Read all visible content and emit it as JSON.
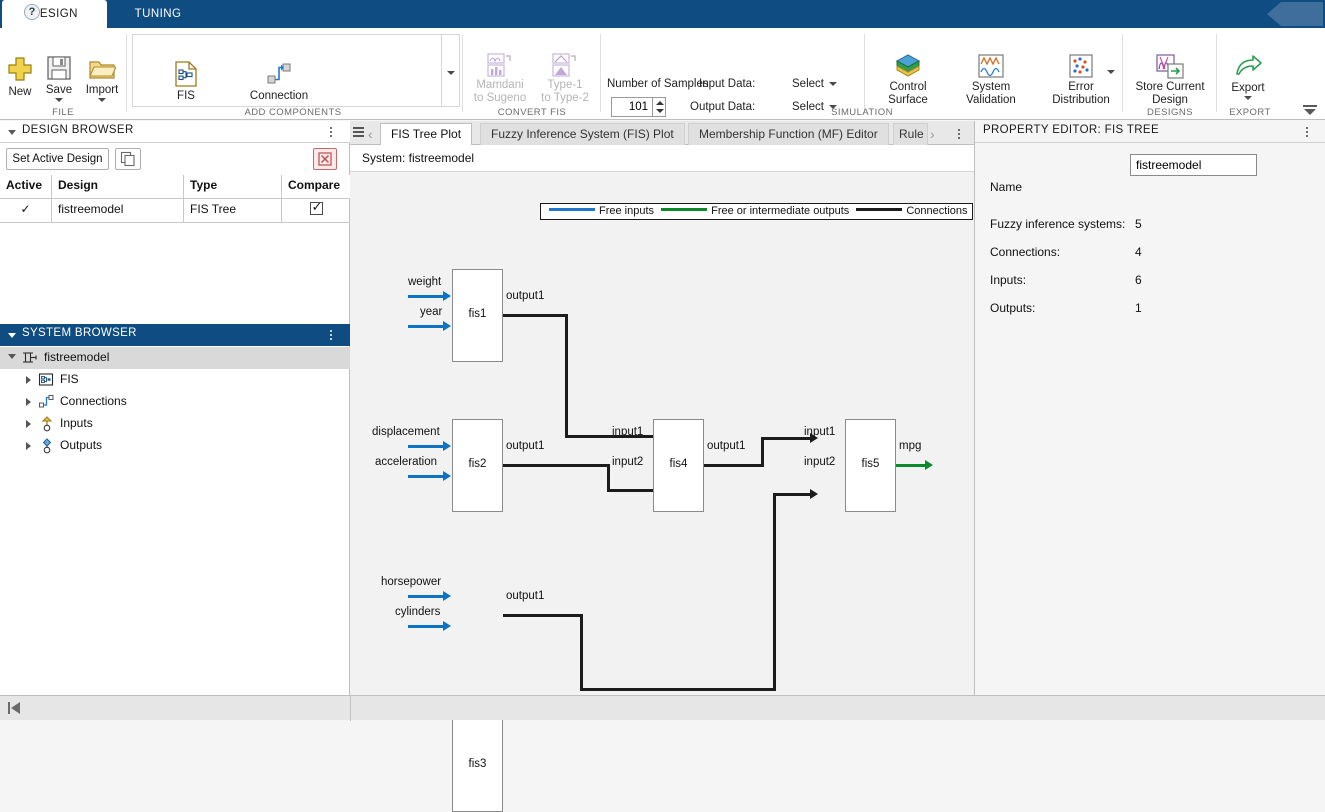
{
  "ribbon_tabs": [
    {
      "id": "design",
      "label": "DESIGN",
      "active": true
    },
    {
      "id": "tuning",
      "label": "TUNING",
      "active": false
    }
  ],
  "help": {
    "icon": "help-question-icon",
    "glyph": "?"
  },
  "ribbon": {
    "file_group": {
      "label": "FILE",
      "buttons": [
        {
          "id": "new",
          "label": "New",
          "icon": "plus-icon",
          "has_caret": false
        },
        {
          "id": "save",
          "label": "Save",
          "icon": "floppy-disk-icon",
          "has_caret": true
        },
        {
          "id": "import",
          "label": "Import",
          "icon": "folder-open-icon",
          "has_caret": true
        }
      ]
    },
    "add_components_group": {
      "label": "ADD COMPONENTS",
      "buttons": [
        {
          "id": "fis",
          "label": "FIS",
          "icon": "fis-document-icon"
        },
        {
          "id": "connection",
          "label": "Connection",
          "icon": "connection-node-icon"
        }
      ]
    },
    "convert_fis_group": {
      "label": "CONVERT FIS",
      "buttons": [
        {
          "id": "mamdani-to-sugeno",
          "label": "Mamdani\nto Sugeno",
          "line1": "Mamdani",
          "line2": "to Sugeno",
          "icon": "mamdani-sugeno-icon",
          "disabled": true
        },
        {
          "id": "type1-to-type2",
          "label": "Type-1\nto Type-2",
          "line1": "Type-1",
          "line2": "to Type-2",
          "icon": "type1-type2-icon",
          "disabled": true
        }
      ]
    },
    "simulation_group": {
      "label": "SIMULATION",
      "number_of_samples_label": "Number of Samples",
      "number_of_samples_value": "101",
      "input_data_label": "Input Data:",
      "input_data_value": "Select",
      "output_data_label": "Output Data:",
      "output_data_value": "Select",
      "buttons": [
        {
          "id": "control-surface",
          "line1": "Control",
          "line2": "Surface",
          "icon": "surface-plot-icon"
        },
        {
          "id": "system-validation",
          "line1": "System",
          "line2": "Validation",
          "icon": "waveform-icon"
        },
        {
          "id": "error-distribution",
          "line1": "Error",
          "line2": "Distribution",
          "icon": "scatter-dots-icon"
        }
      ]
    },
    "designs_group": {
      "label": "DESIGNS",
      "buttons": [
        {
          "id": "store-current-design",
          "line1": "Store Current",
          "line2": "Design",
          "icon": "store-design-icon"
        }
      ]
    },
    "export_group": {
      "label": "EXPORT",
      "buttons": [
        {
          "id": "export",
          "label": "Export",
          "icon": "export-arrow-icon",
          "has_caret": true
        }
      ]
    }
  },
  "design_browser": {
    "title": "DESIGN BROWSER",
    "set_active_label": "Set Active Design",
    "copy_icon": "copy-design-icon",
    "delete_icon": "delete-design-icon",
    "columns": [
      "Active",
      "Design",
      "Type",
      "Compare"
    ],
    "rows": [
      {
        "active": "✓",
        "design": "fistreemodel",
        "type": "FIS Tree",
        "compare": true
      }
    ]
  },
  "system_browser": {
    "title": "SYSTEM BROWSER",
    "tree": [
      {
        "label": "fistreemodel",
        "icon": "fis-tree-icon",
        "expanded": true,
        "level": 0,
        "selected": true
      },
      {
        "label": "FIS",
        "icon": "fis-node-icon",
        "expanded": false,
        "level": 1,
        "selected": false
      },
      {
        "label": "Connections",
        "icon": "connections-node-icon",
        "expanded": false,
        "level": 1,
        "selected": false
      },
      {
        "label": "Inputs",
        "icon": "input-port-icon",
        "expanded": false,
        "level": 1,
        "selected": false
      },
      {
        "label": "Outputs",
        "icon": "output-port-icon",
        "expanded": false,
        "level": 1,
        "selected": false
      }
    ]
  },
  "document": {
    "tabs": [
      {
        "id": "fis-tree-plot",
        "label": "FIS Tree Plot",
        "active": true
      },
      {
        "id": "fis-plot",
        "label": "Fuzzy Inference System (FIS) Plot",
        "active": false
      },
      {
        "id": "mf-editor",
        "label": "Membership Function (MF) Editor",
        "active": false
      },
      {
        "id": "rule-editor",
        "label": "Rule",
        "active": false
      }
    ],
    "system_label": "System: fistreemodel",
    "legend": [
      {
        "label": "Free inputs",
        "color": "#1f77d0"
      },
      {
        "label": "Free or intermediate outputs",
        "color": "#0a8a2a"
      },
      {
        "label": "Connections",
        "color": "#1c1c1c"
      }
    ]
  },
  "diagram": {
    "blocks": [
      {
        "id": "fis1",
        "label": "fis1",
        "inputs": [
          "weight",
          "year"
        ],
        "outputs": [
          "output1"
        ]
      },
      {
        "id": "fis2",
        "label": "fis2",
        "inputs": [
          "displacement",
          "acceleration"
        ],
        "outputs": [
          "output1"
        ]
      },
      {
        "id": "fis3",
        "label": "fis3",
        "inputs": [
          "horsepower",
          "cylinders"
        ],
        "outputs": [
          "output1"
        ]
      },
      {
        "id": "fis4",
        "label": "fis4",
        "inputs": [
          "input1",
          "input2"
        ],
        "outputs": [
          "output1"
        ]
      },
      {
        "id": "fis5",
        "label": "fis5",
        "inputs": [
          "input1",
          "input2"
        ],
        "outputs": [
          "mpg"
        ]
      }
    ],
    "labels": {
      "weight": "weight",
      "year": "year",
      "displacement": "displacement",
      "acceleration": "acceleration",
      "horsepower": "horsepower",
      "cylinders": "cylinders",
      "fis1_out": "output1",
      "fis2_out": "output1",
      "fis3_out": "output1",
      "fis4_out": "output1",
      "fis4_in1": "input1",
      "fis4_in2": "input2",
      "fis5_in1": "input1",
      "fis5_in2": "input2",
      "mpg": "mpg"
    }
  },
  "property_editor": {
    "title": "PROPERTY EDITOR: FIS TREE",
    "name_label": "Name",
    "name_value": "fistreemodel",
    "fields": [
      {
        "label": "Fuzzy inference systems:",
        "value": "5"
      },
      {
        "label": "Connections:",
        "value": "4"
      },
      {
        "label": "Inputs:",
        "value": "6"
      },
      {
        "label": "Outputs:",
        "value": "1"
      }
    ]
  },
  "status_bar": {
    "go_to_start_icon": "go-to-start-icon"
  },
  "colors": {
    "ribbon_blue": "#0e4c81",
    "accent_blue": "#1f77d0",
    "green": "#0a8a2a",
    "wire": "#1c1c1c",
    "panel_bg": "#f5f5f5",
    "canvas_bg": "#f2f2f2"
  }
}
